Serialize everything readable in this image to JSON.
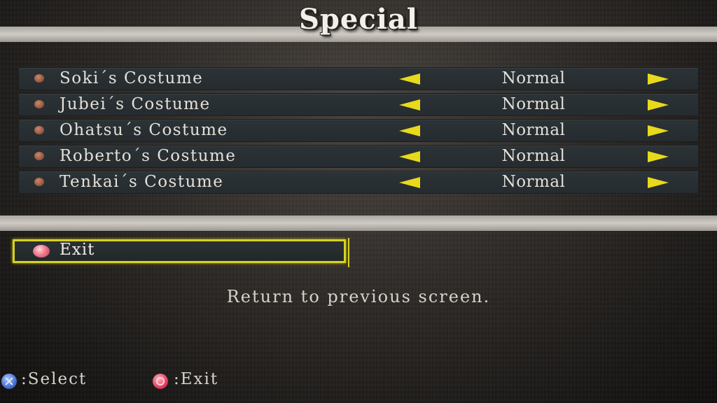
{
  "screen": {
    "title": "Special"
  },
  "options": [
    {
      "label": "Soki´s Costume",
      "value": "Normal"
    },
    {
      "label": "Jubei´s Costume",
      "value": "Normal"
    },
    {
      "label": "Ohatsu´s Costume",
      "value": "Normal"
    },
    {
      "label": "Roberto´s Costume",
      "value": "Normal"
    },
    {
      "label": "Tenkai´s Costume",
      "value": "Normal"
    }
  ],
  "exit": {
    "label": "Exit"
  },
  "description": "Return to previous screen.",
  "footer": {
    "select_label": ":Select",
    "exit_label": ":Exit"
  },
  "icons": {
    "option_bullet": "bullet-icon",
    "left_arrow": "arrow-left-icon",
    "right_arrow": "arrow-right-icon",
    "cross_button": "cross-button-icon",
    "circle_button": "circle-button-icon"
  },
  "colors": {
    "highlight": "#d6d21e",
    "arrow": "#e8d91c"
  }
}
